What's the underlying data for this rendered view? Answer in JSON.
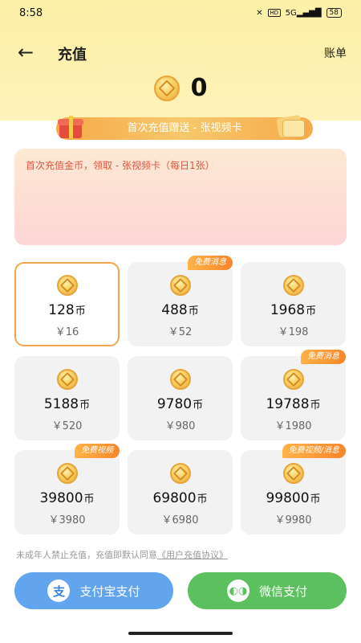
{
  "status_bar": {
    "time": "8:58",
    "network": "5G",
    "hd": "HD",
    "battery": "58"
  },
  "header": {
    "title": "充值",
    "bill_label": "账单",
    "back_icon": "back-arrow-icon"
  },
  "balance": {
    "value": "0"
  },
  "promo": {
    "banner_text": "首次充值赠送 - 张视频卡",
    "info_text": "首次充值金币，领取 - 张视频卡（每日1张）"
  },
  "packages": [
    {
      "amount": "128",
      "unit": "币",
      "price": "￥16",
      "badge": "",
      "selected": true
    },
    {
      "amount": "488",
      "unit": "币",
      "price": "￥52",
      "badge": "免费消息"
    },
    {
      "amount": "1968",
      "unit": "币",
      "price": "￥198",
      "badge": ""
    },
    {
      "amount": "5188",
      "unit": "币",
      "price": "￥520",
      "badge": ""
    },
    {
      "amount": "9780",
      "unit": "币",
      "price": "￥980",
      "badge": ""
    },
    {
      "amount": "19788",
      "unit": "币",
      "price": "￥1980",
      "badge": "免费消息"
    },
    {
      "amount": "39800",
      "unit": "币",
      "price": "￥3980",
      "badge": "免费视频"
    },
    {
      "amount": "69800",
      "unit": "币",
      "price": "￥6980",
      "badge": ""
    },
    {
      "amount": "99800",
      "unit": "币",
      "price": "￥9980",
      "badge": "免费视频/消息"
    }
  ],
  "agreement": {
    "text": "未成年人禁止充值，充值即默认同意",
    "link": "《用户充值协议》"
  },
  "payment": {
    "alipay_label": "支付宝支付",
    "alipay_icon": "支",
    "wechat_label": "微信支付",
    "wechat_icon": "◐◑"
  },
  "colors": {
    "accent": "#f1a64a",
    "alipay": "#63a4ee",
    "wechat": "#5bc05d",
    "promo_text": "#e2553f"
  }
}
